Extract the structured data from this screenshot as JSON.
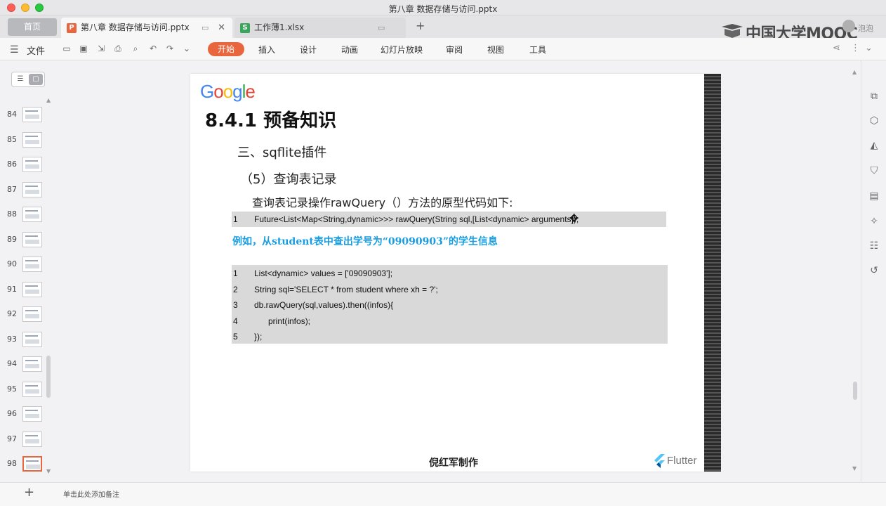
{
  "window": {
    "title": "第八章 数据存储与访问.pptx"
  },
  "tabs": {
    "home_label": "首页",
    "items": [
      {
        "label": "第八章 数据存储与访问.pptx",
        "file_icon": "P",
        "color": "#e9653d"
      },
      {
        "label": "工作薄1.xlsx",
        "file_icon": "S",
        "color": "#3aa55c"
      }
    ]
  },
  "branding": {
    "mooc": "中国大学MOOC",
    "user": "泡泡"
  },
  "ribbon": {
    "file_label": "文件",
    "tabs": [
      "开始",
      "插入",
      "设计",
      "动画",
      "幻灯片放映",
      "审阅",
      "视图",
      "工具"
    ],
    "active_tab": "开始"
  },
  "thumbnails": {
    "numbers": [
      "84",
      "85",
      "86",
      "87",
      "88",
      "89",
      "90",
      "91",
      "92",
      "93",
      "94",
      "95",
      "96",
      "97",
      "98"
    ],
    "active": "98"
  },
  "slide": {
    "logo": "Google",
    "heading": "8.4.1  预备知识",
    "sub1": "三、sqflite插件",
    "sub2": "（5）查询表记录",
    "sub3": "查询表记录操作rawQuery（）方法的原型代码如下:",
    "proto_line": {
      "num": "1",
      "code": "Future<List<Map<String,dynamic>>> rawQuery(String sql,[List<dynamic> arguments]);"
    },
    "example": "例如，从student表中查出学号为“09090903”的学生信息",
    "code_lines": [
      {
        "num": "1",
        "code": "List<dynamic> values = ['09090903'];"
      },
      {
        "num": "2",
        "code": "String sql='SELECT * from student where xh = ?';"
      },
      {
        "num": "3",
        "code": "db.rawQuery(sql,values).then((infos){"
      },
      {
        "num": "4",
        "code": "print(infos);"
      },
      {
        "num": "5",
        "code": "});"
      }
    ],
    "author": "倪红军制作",
    "flutter": "Flutter"
  },
  "bottom": {
    "notes_placeholder": "单击此处添加备注",
    "add_label": "+"
  },
  "colors": {
    "accent": "#e9653d",
    "example_blue": "#1a9de0"
  }
}
